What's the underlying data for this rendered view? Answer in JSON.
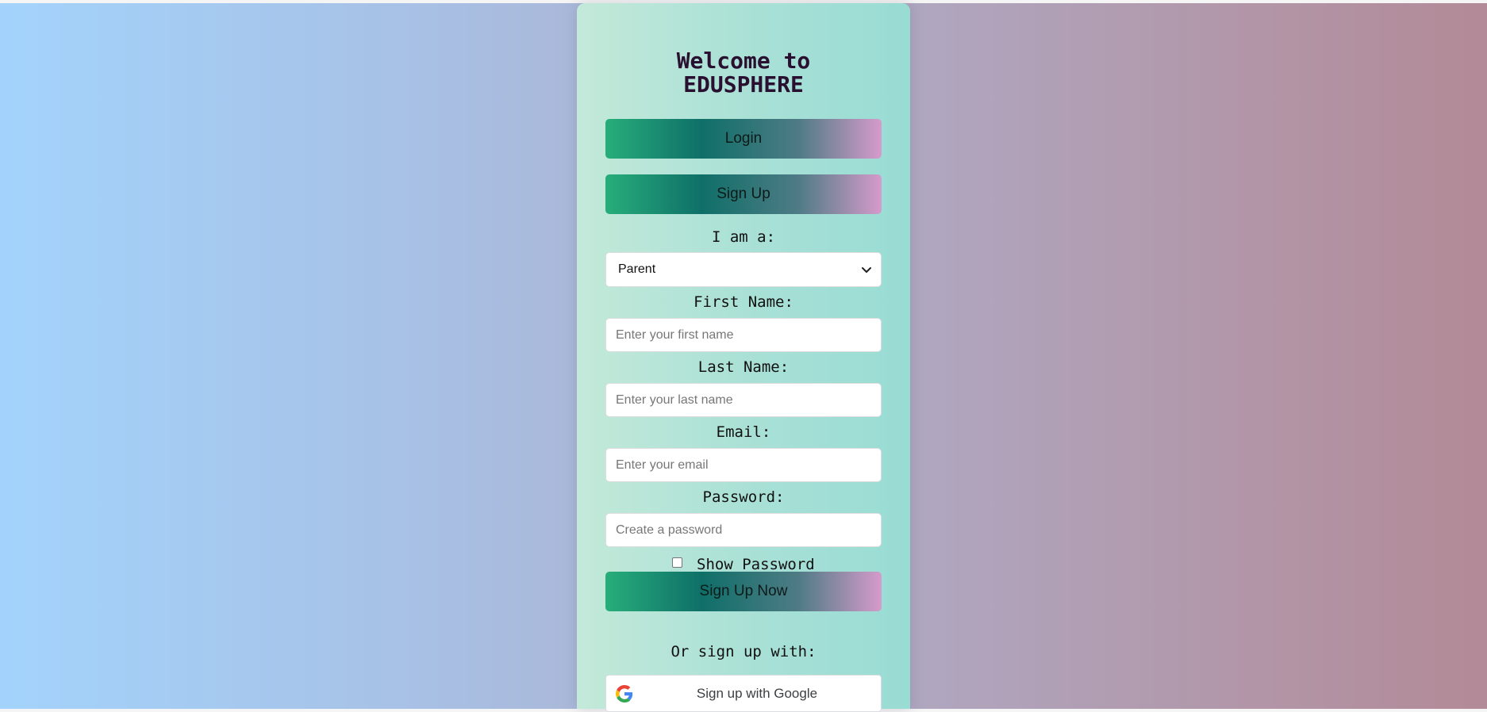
{
  "form": {
    "title_line1": "Welcome to",
    "title_line2": "EDUSPHERE",
    "tabs": {
      "login": "Login",
      "signup": "Sign Up"
    },
    "role": {
      "label": "I am a:",
      "selected": "Parent"
    },
    "first_name": {
      "label": "First Name:",
      "placeholder": "Enter your first name"
    },
    "last_name": {
      "label": "Last Name:",
      "placeholder": "Enter your last name"
    },
    "email": {
      "label": "Email:",
      "placeholder": "Enter your email"
    },
    "password": {
      "label": "Password:",
      "placeholder": "Create a password"
    },
    "show_password": {
      "label": "Show Password",
      "checked": false
    },
    "submit_label": "Sign Up Now",
    "alt_signup_label": "Or sign up with:",
    "google_label": "Sign up with Google"
  },
  "colors": {
    "background_left": "#a3d3fc",
    "background_right": "#b38a97",
    "card": "#a8e0d6",
    "button_green": "#27ae7a",
    "button_teal": "#0f6f68",
    "button_pink": "#d69bcb",
    "title_text": "#2a1030"
  },
  "icons": {
    "role_dropdown": "chevron-down-icon",
    "google": "google-logo-icon"
  }
}
